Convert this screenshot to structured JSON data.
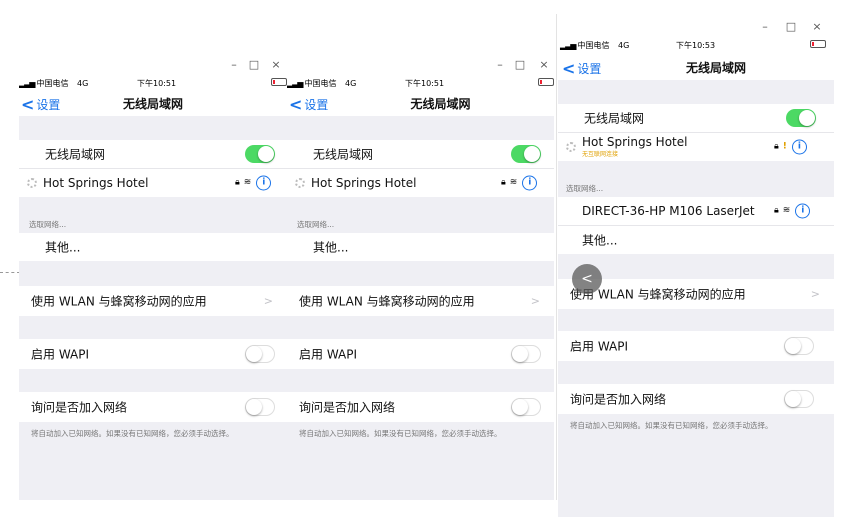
{
  "windows": [
    {
      "time": "下午10:51",
      "carrier": "中国电信",
      "network": "4G",
      "back_label": "设置",
      "nav_title": "无线局域网",
      "wlan_label": "无线局域网",
      "wlan_on": true,
      "connected_ssid": "Hot Springs Hotel",
      "choose_network_caption": "选取网络...",
      "other_label": "其他...",
      "apps_label": "使用 WLAN 与蜂窝移动网的应用",
      "wapi_label": "启用 WAPI",
      "ask_label": "询问是否加入网络",
      "footer_note": "将自动加入已知网络。如果没有已知网络，您必须手动选择。",
      "window_buttons": {
        "minimize": "–",
        "maximize": "□",
        "close": "×"
      }
    },
    {
      "time": "下午10:51",
      "carrier": "中国电信",
      "network": "4G",
      "back_label": "设置",
      "nav_title": "无线局域网",
      "wlan_label": "无线局域网",
      "wlan_on": true,
      "connected_ssid": "Hot Springs Hotel",
      "choose_network_caption": "选取网络...",
      "other_label": "其他...",
      "apps_label": "使用 WLAN 与蜂窝移动网的应用",
      "wapi_label": "启用 WAPI",
      "ask_label": "询问是否加入网络",
      "footer_note": "将自动加入已知网络。如果没有已知网络，您必须手动选择。",
      "window_buttons": {
        "minimize": "–",
        "maximize": "□",
        "close": "×"
      }
    },
    {
      "time": "下午10:53",
      "carrier": "中国电信",
      "network": "4G",
      "back_label": "设置",
      "nav_title": "无线局域网",
      "wlan_label": "无线局域网",
      "wlan_on": true,
      "connected_ssid": "Hot Springs Hotel",
      "connected_subtitle": "无互联网连接",
      "choose_network_caption": "选取网络...",
      "extra_network": "DIRECT-36-HP M106 LaserJet",
      "other_label": "其他...",
      "apps_label": "使用 WLAN 与蜂窝移动网的应用",
      "wapi_label": "启用 WAPI",
      "ask_label": "询问是否加入网络",
      "footer_note": "将自动加入已知网络。如果没有已知网络，您必须手动选择。",
      "window_buttons": {
        "minimize": "–",
        "maximize": "□",
        "close": "×"
      }
    }
  ],
  "icons": {
    "lock": "lock-icon",
    "wifi": "wifi-icon",
    "info": "info-icon",
    "warning": "warning-icon",
    "chevron": "chevron-right-icon",
    "back": "chevron-left-icon"
  },
  "colors": {
    "accent": "#1a73e8",
    "toggle_on": "#4cd964",
    "section_bg": "#efeff4",
    "warning": "#e0a000"
  },
  "glyphs": {
    "lock": "🔒",
    "wifi": "≋",
    "info": "i",
    "warning": "!",
    "chevron": ">",
    "back_chevron": "<",
    "overlay_back": "<"
  }
}
